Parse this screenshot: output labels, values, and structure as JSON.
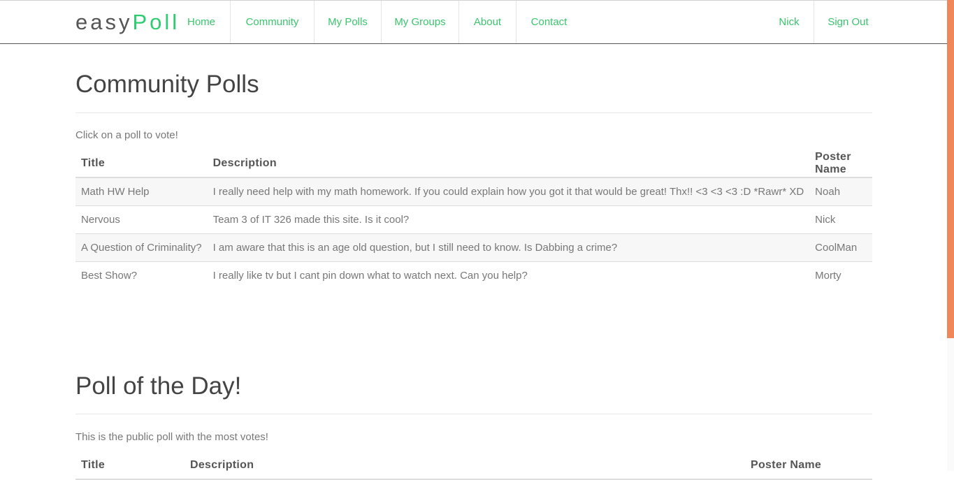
{
  "nav": {
    "brand_prefix": "easy",
    "brand_suffix": "Poll",
    "items": [
      "Home",
      "Community",
      "My Polls",
      "My Groups",
      "About",
      "Contact"
    ],
    "user": "Nick",
    "signout": "Sign Out"
  },
  "community": {
    "title": "Community Polls",
    "subtitle": "Click on a poll to vote!",
    "headers": [
      "Title",
      "Description",
      "Poster Name"
    ],
    "rows": [
      {
        "title": "Math HW Help",
        "description": "I really need help with my math homework. If you could explain how you got it that would be great! Thx!! <3 <3 <3 :D *Rawr* XD",
        "poster": "Noah"
      },
      {
        "title": "Nervous",
        "description": "Team 3 of IT 326 made this site. Is it cool?",
        "poster": "Nick"
      },
      {
        "title": "A Question of Criminality?",
        "description": "I am aware that this is an age old question, but I still need to know. Is Dabbing a crime?",
        "poster": "CoolMan"
      },
      {
        "title": "Best Show?",
        "description": "I really like tv but I cant pin down what to watch next. Can you help?",
        "poster": "Morty"
      }
    ]
  },
  "potd": {
    "title": "Poll of the Day!",
    "subtitle": "This is the public poll with the most votes!",
    "headers": [
      "Title",
      "Description",
      "Poster Name"
    ]
  },
  "colors": {
    "accent": "#3ac56d",
    "scrollbar": "#f0875b"
  }
}
